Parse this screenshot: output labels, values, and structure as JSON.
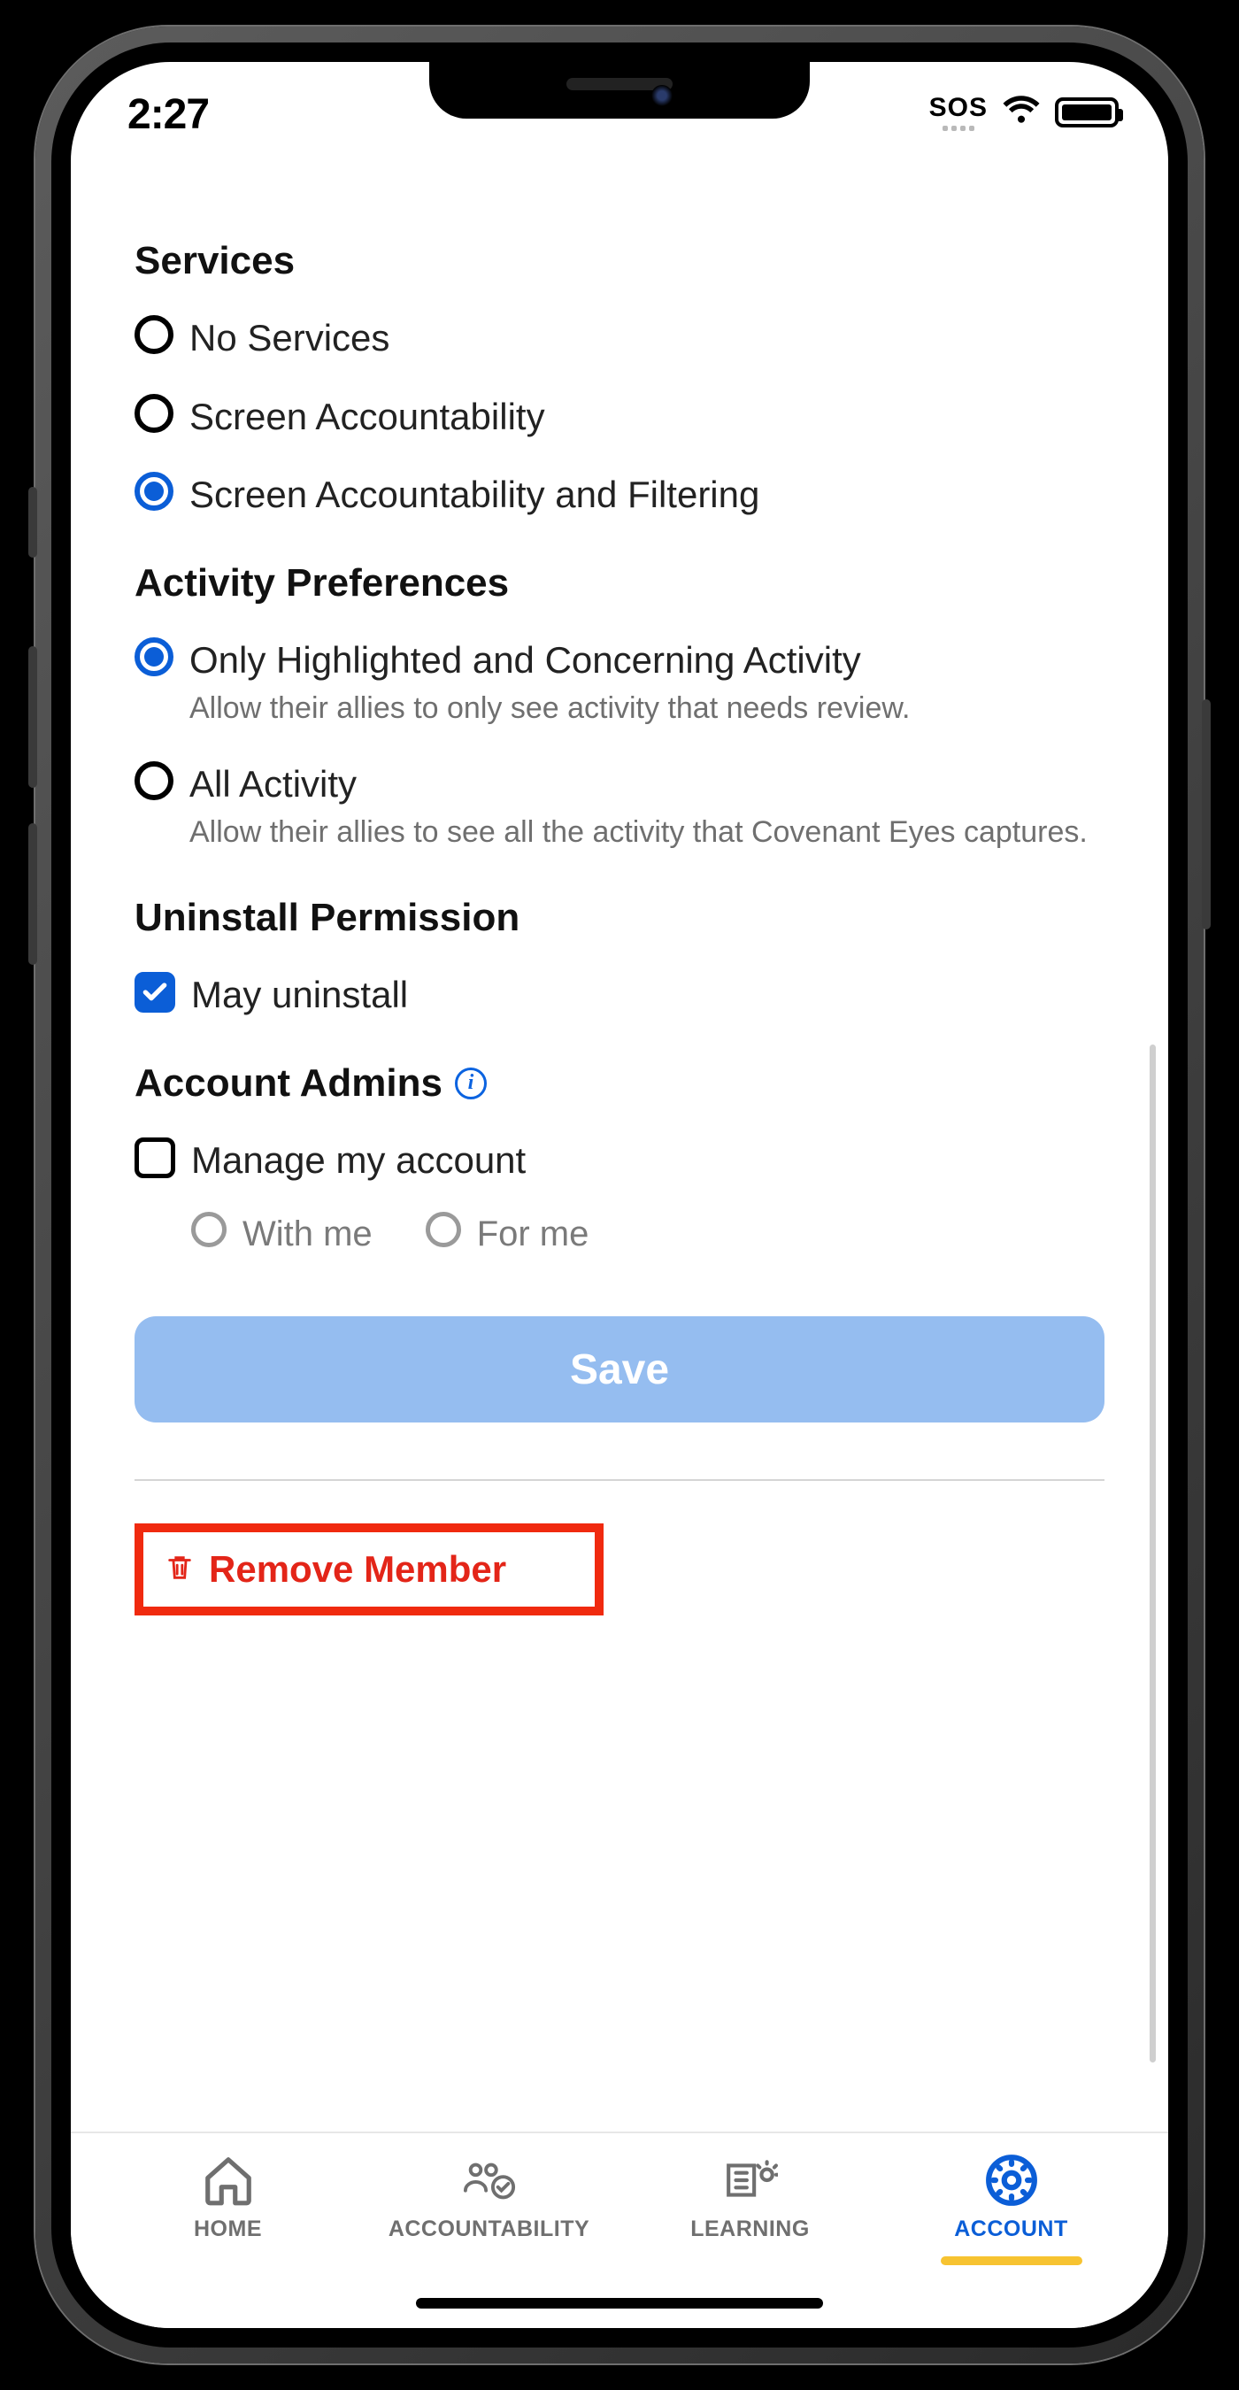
{
  "status": {
    "time": "2:27",
    "sos": "SOS"
  },
  "sections": {
    "services": {
      "title": "Services",
      "options": [
        {
          "label": "No Services",
          "selected": false
        },
        {
          "label": "Screen Accountability",
          "selected": false
        },
        {
          "label": "Screen Accountability and Filtering",
          "selected": true
        }
      ]
    },
    "activity": {
      "title": "Activity Preferences",
      "options": [
        {
          "label": "Only Highlighted and Concerning Activity",
          "desc": "Allow their allies to only see activity that needs review.",
          "selected": true
        },
        {
          "label": "All Activity",
          "desc": "Allow their allies to see all the activity that Covenant Eyes captures.",
          "selected": false
        }
      ]
    },
    "uninstall": {
      "title": "Uninstall Permission",
      "option": {
        "label": "May uninstall",
        "checked": true
      }
    },
    "admins": {
      "title": "Account Admins",
      "option": {
        "label": "Manage my account",
        "checked": false
      },
      "sub": [
        {
          "label": "With me",
          "selected": false
        },
        {
          "label": "For me",
          "selected": false
        }
      ]
    }
  },
  "buttons": {
    "save": "Save",
    "remove": "Remove Member"
  },
  "tabs": {
    "home": "HOME",
    "accountability": "ACCOUNTABILITY",
    "learning": "LEARNING",
    "account": "ACCOUNT",
    "active": "account"
  },
  "colors": {
    "accent": "#0b5ed7",
    "danger": "#e32518",
    "highlight": "#f02a0f",
    "save": "#95bdf0"
  }
}
